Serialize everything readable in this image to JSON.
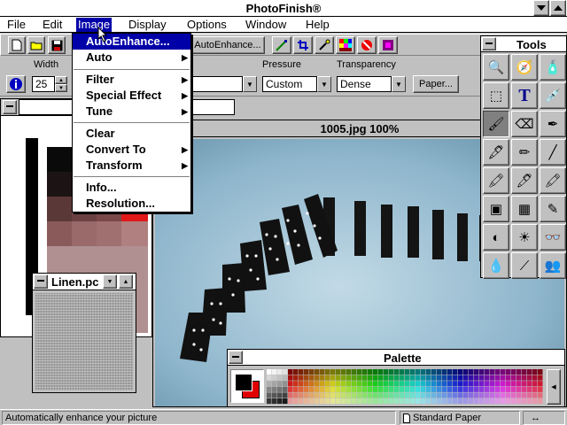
{
  "app": {
    "title": "PhotoFinish®"
  },
  "menubar": {
    "items": [
      {
        "label": "File"
      },
      {
        "label": "Edit"
      },
      {
        "label": "Image"
      },
      {
        "label": "Display"
      },
      {
        "label": "Options"
      },
      {
        "label": "Window"
      },
      {
        "label": "Help"
      }
    ],
    "active": "Image"
  },
  "image_menu": {
    "items": [
      {
        "label": "AutoEnhance...",
        "submenu": false,
        "highlighted": true
      },
      {
        "label": "Auto",
        "submenu": true
      },
      {
        "label": "Filter",
        "submenu": true
      },
      {
        "label": "Special Effect",
        "submenu": true
      },
      {
        "label": "Tune",
        "submenu": true
      },
      {
        "label": "Clear",
        "submenu": false
      },
      {
        "label": "Convert To",
        "submenu": true
      },
      {
        "label": "Transform",
        "submenu": true
      },
      {
        "label": "Info...",
        "submenu": false
      },
      {
        "label": "Resolution...",
        "submenu": false
      }
    ]
  },
  "toolbar": {
    "autoenhance_label": "AutoEnhance...",
    "icons": [
      "new-file",
      "open-folder",
      "save-disk",
      "wand",
      "crop",
      "magic",
      "color-grid",
      "no-sign",
      "filter"
    ]
  },
  "ribbon": {
    "width_label": "Width",
    "width_value": "25",
    "pressure_label": "Pressure",
    "pressure_value": "Custom",
    "transparency_label": "Transparency",
    "transparency_value": "Dense",
    "paper_button": "Paper..."
  },
  "document": {
    "title": "1005.jpg  100%"
  },
  "linen_window": {
    "title": "Linen.pc"
  },
  "tools": {
    "title": "Tools",
    "icons": [
      "zoom-magnifier",
      "compass",
      "spray-can",
      "marquee-select",
      "text-tool",
      "eyedropper",
      "paintbrush",
      "eraser",
      "airbrush-pen",
      "pen",
      "pencil",
      "line-tool",
      "highlighter",
      "marker",
      "crayon",
      "stamp",
      "pattern-fill",
      "quill",
      "contrast-circle",
      "brightness-sun",
      "glasses-clone",
      "water-drop",
      "smudge-brush",
      "people-clone"
    ],
    "pressed": "paintbrush"
  },
  "palette": {
    "title": "Palette",
    "primary_color": "#000000",
    "secondary_color": "#e00000"
  },
  "status": {
    "message": "Automatically enhance your picture",
    "paper": "Standard Paper",
    "arrows": "↔"
  }
}
